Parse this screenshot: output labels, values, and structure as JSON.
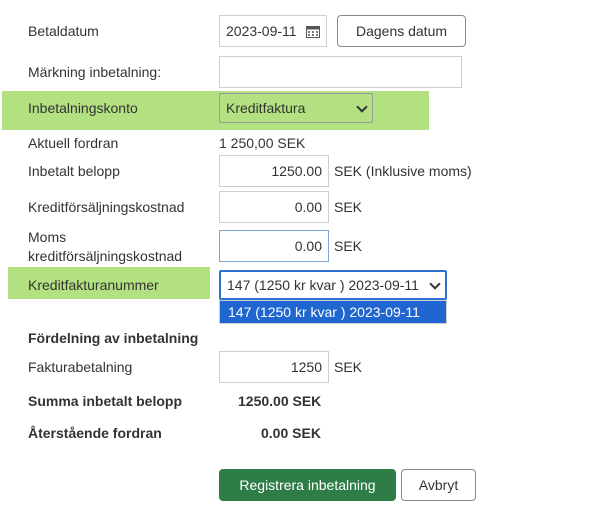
{
  "form": {
    "betaldatum_label": "Betaldatum",
    "betaldatum_value": "2023-09-11",
    "dagens_datum_button": "Dagens datum",
    "markning_label": "Märkning inbetalning:",
    "markning_value": "",
    "inbetalningskonto_label": "Inbetalningskonto",
    "inbetalningskonto_value": "Kreditfaktura",
    "aktuell_fordran_label": "Aktuell fordran",
    "aktuell_fordran_value": "1 250,00 SEK",
    "inbetalt_belopp_label": "Inbetalt belopp",
    "inbetalt_belopp_value": "1250.00",
    "inbetalt_belopp_unit": "SEK (Inklusive moms)",
    "kreditforsaljningskostnad_label": "Kreditförsäljningskostnad",
    "kreditforsaljningskostnad_value": "0.00",
    "kreditforsaljningskostnad_unit": "SEK",
    "moms_label_line1": "Moms",
    "moms_label_line2": "kreditförsäljningskostnad",
    "moms_value": "0.00",
    "moms_unit": "SEK",
    "kreditfakturanummer_label": "Kreditfakturanummer",
    "kreditfakturanummer_value": "147 (1250 kr kvar ) 2023-09-11",
    "kreditfakturanummer_options": [
      "147 (1250 kr kvar ) 2023-09-11"
    ]
  },
  "fordelning": {
    "heading": "Fördelning av inbetalning",
    "fakturabetalning_label": "Fakturabetalning",
    "fakturabetalning_value": "1250",
    "fakturabetalning_unit": "SEK",
    "summa_label": "Summa inbetalt belopp",
    "summa_value": "1250.00 SEK",
    "aterstaende_label": "Återstående fordran",
    "aterstaende_value": "0.00 SEK"
  },
  "actions": {
    "register_button": "Registrera inbetalning",
    "cancel_button": "Avbryt"
  },
  "colors": {
    "highlight": "#b3e080",
    "primary_button": "#2e7d46",
    "dropdown_selected": "#1f66d1"
  },
  "icons": {
    "calendar": "calendar-icon",
    "dropdown": "chevron-down-icon"
  }
}
